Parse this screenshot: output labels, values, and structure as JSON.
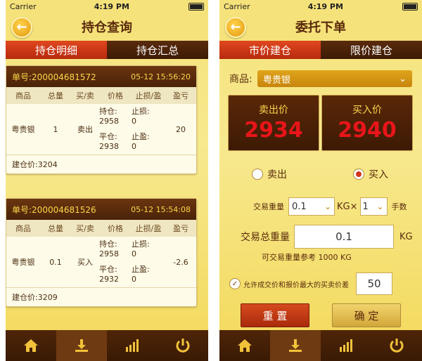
{
  "status": {
    "carrier": "Carrier",
    "time": "4:19 PM"
  },
  "left": {
    "title": "持仓查询",
    "tabs": [
      "持仓明细",
      "持仓汇总"
    ],
    "columns": [
      "商品",
      "总量",
      "买/卖",
      "价格",
      "止损/盈",
      "盈亏"
    ],
    "cards": [
      {
        "order": "单号:200004681572",
        "date": "05-12 15:56:20",
        "product": "粤贵银",
        "qty": "1",
        "side": "卖出",
        "hold_label": "持仓:",
        "hold_price": "2958",
        "close_label": "平仓:",
        "close_price": "2938",
        "sl_label": "止损:",
        "sl_value": "0",
        "tp_label": "止盈:",
        "tp_value": "0",
        "pnl": "20",
        "open": "建仓价:3204"
      },
      {
        "order": "单号:200004681526",
        "date": "05-12 15:54:08",
        "product": "粤贵银",
        "qty": "0.1",
        "side": "买入",
        "hold_label": "持仓:",
        "hold_price": "2958",
        "close_label": "平仓:",
        "close_price": "2932",
        "sl_label": "止损:",
        "sl_value": "0",
        "tp_label": "止盈:",
        "tp_value": "0",
        "pnl": "-2.6",
        "open": "建仓价:3209"
      }
    ]
  },
  "right": {
    "title": "委托下单",
    "tabs": [
      "市价建仓",
      "限价建仓"
    ],
    "product_label": "商品:",
    "product_value": "粤贵银",
    "sell_title": "卖出价",
    "sell_price": "2934",
    "buy_title": "买入价",
    "buy_price": "2940",
    "radio_sell": "卖出",
    "radio_buy": "买入",
    "weight_label": "交易重量",
    "weight_value": "0.1",
    "unit_kg": "KG×",
    "lots_value": "1",
    "lots_label": "手数",
    "total_label": "交易总重量",
    "total_value": "0.1",
    "total_unit": "KG",
    "ref_text": "可交易重量参考 1000 KG",
    "slip_label": "允许成交价和报价最大的买卖价差",
    "slip_value": "50",
    "reset_button": "重 置",
    "confirm_button": "确 定"
  },
  "colors": {
    "accent_red": "#b72a0e",
    "brown": "#4a2308",
    "gold": "#fbd64a",
    "price_red": "#e8151a"
  },
  "tabbar_icons": [
    "home-icon",
    "download-icon",
    "chart-bars-icon",
    "power-icon"
  ]
}
